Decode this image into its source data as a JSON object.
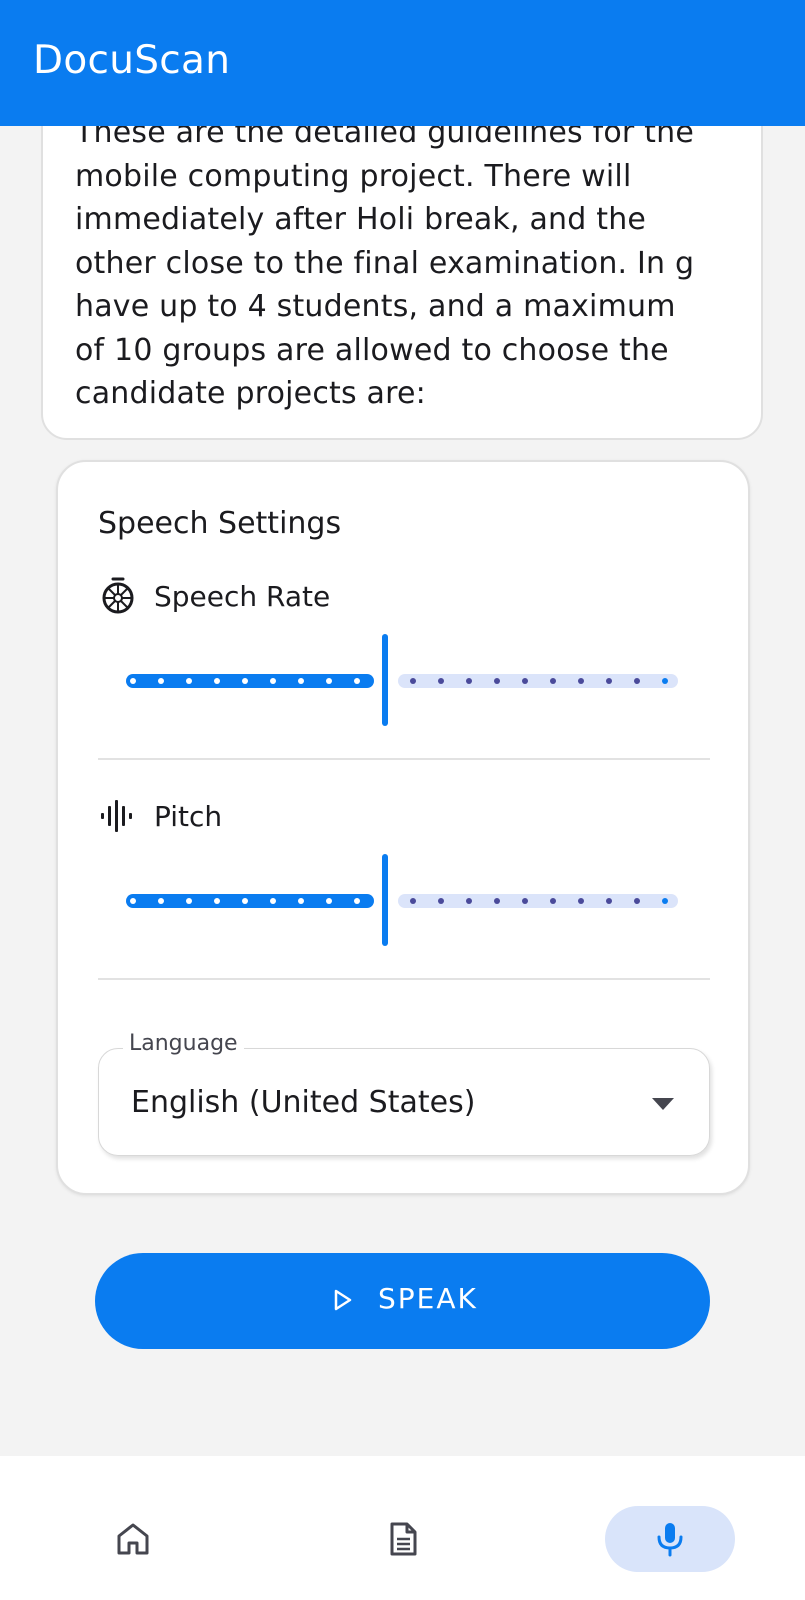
{
  "app": {
    "title": "DocuScan"
  },
  "document": {
    "text": "These are the detailed guidelines for the\nmobile computing project. There will\nimmediately after Holi break, and the\nother close to the final examination. In g\nhave up to 4 students, and a maximum\nof 10 groups are allowed to choose the\ncandidate projects are:"
  },
  "settings": {
    "title": "Speech Settings",
    "speech_rate": {
      "label": "Speech Rate",
      "icon": "speed-icon",
      "value_fraction": 0.47
    },
    "pitch": {
      "label": "Pitch",
      "icon": "graphic-eq-icon",
      "value_fraction": 0.47
    },
    "language": {
      "legend": "Language",
      "value": "English (United States)",
      "icon": "dropdown-caret-icon"
    }
  },
  "speak_button": {
    "label": "SPEAK",
    "icon": "play-icon"
  },
  "bottom_nav": {
    "items": [
      {
        "icon": "home-icon",
        "active": false
      },
      {
        "icon": "document-icon",
        "active": false
      },
      {
        "icon": "mic-icon",
        "active": true
      }
    ]
  },
  "colors": {
    "primary": "#0a7cf0",
    "slider_inactive": "#dbe4fa",
    "nav_active_bg": "#d9e4fa",
    "background": "#f3f3f3"
  }
}
